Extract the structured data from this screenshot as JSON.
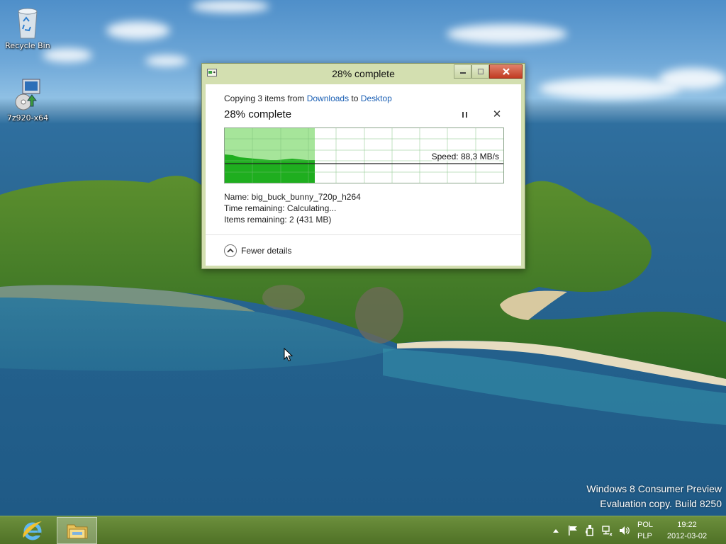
{
  "desktop": {
    "icons": [
      {
        "label": "Recycle Bin",
        "icon": "recycle-bin-icon"
      },
      {
        "label": "7z920-x64",
        "icon": "installer-icon"
      }
    ],
    "watermark": {
      "line1": "Windows 8 Consumer Preview",
      "line2": "Evaluation copy. Build 8250"
    }
  },
  "dialog": {
    "title": "28% complete",
    "copy_prefix": "Copying 3 items from ",
    "source": "Downloads",
    "copy_mid": " to ",
    "destination": "Desktop",
    "heading": "28% complete",
    "progress": 0.28,
    "speed": "Speed: 88,3 MB/s",
    "name_line": "Name:  big_buck_bunny_720p_h264",
    "time_line": "Time remaining:  Calculating...",
    "items_line": "Items remaining:  2 (431 MB)",
    "fewer_details": "Fewer details",
    "accent_color": "#1fae1f",
    "progress_color": "#a6e59a"
  },
  "taskbar": {
    "pinned": [
      {
        "name": "internet-explorer",
        "icon": "ie-icon"
      },
      {
        "name": "file-explorer",
        "icon": "folder-icon",
        "active": true
      }
    ],
    "tray_icons": [
      "chevron-up-icon",
      "flag-icon",
      "usb-icon",
      "network-icon",
      "volume-icon"
    ],
    "lang_top": "POL",
    "lang_bottom": "PLP",
    "time": "19:22",
    "date": "2012-03-02"
  }
}
